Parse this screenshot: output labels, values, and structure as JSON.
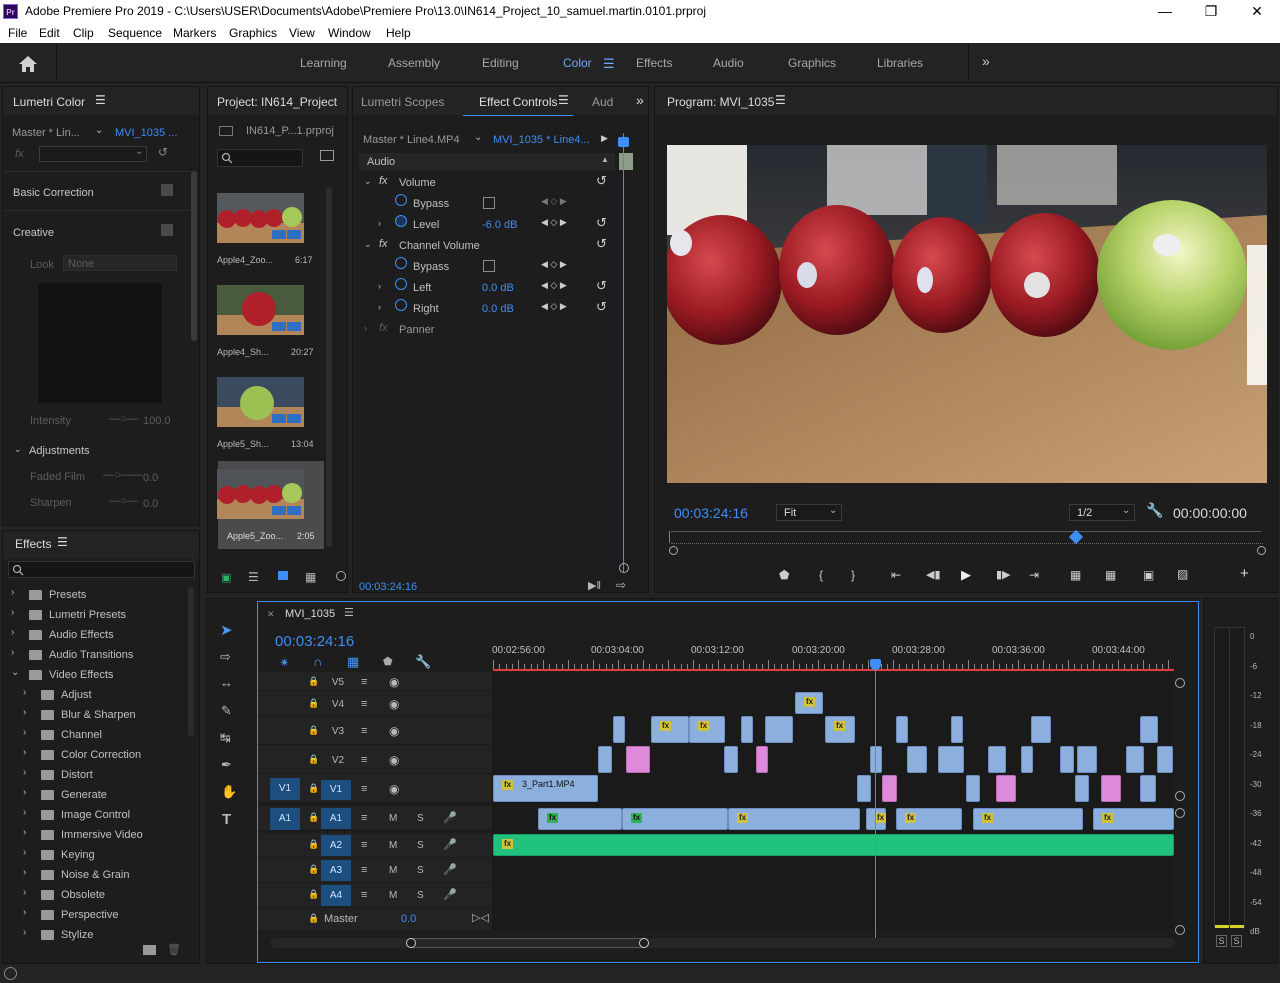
{
  "app": {
    "title": "Adobe Premiere Pro 2019 - C:\\Users\\USER\\Documents\\Adobe\\Premiere Pro\\13.0\\IN614_Project_10_samuel.martin.0101.prproj",
    "logo": "Pr"
  },
  "menu": [
    "File",
    "Edit",
    "Clip",
    "Sequence",
    "Markers",
    "Graphics",
    "View",
    "Window",
    "Help"
  ],
  "workspaces": [
    "Learning",
    "Assembly",
    "Editing",
    "Color",
    "Effects",
    "Audio",
    "Graphics",
    "Libraries"
  ],
  "workspace_active": "Color",
  "lumetri": {
    "title": "Lumetri Color",
    "source": "Master * Lin...",
    "clip": "MVI_1035 ...",
    "fx": "fx",
    "basic": "Basic Correction",
    "creative": "Creative",
    "look_label": "Look",
    "look_value": "None",
    "intensity_label": "Intensity",
    "intensity_value": "100.0",
    "adjustments": "Adjustments",
    "faded_film": "Faded Film",
    "faded_value": "0.0",
    "sharpen": "Sharpen",
    "sharpen_value": "0.0"
  },
  "project": {
    "title": "Project: IN614_Project",
    "file": "IN614_P...1.prproj",
    "items": [
      {
        "name": "Apple4_Zoo...",
        "dur": "6:17"
      },
      {
        "name": "Apple4_Sh...",
        "dur": "20:27"
      },
      {
        "name": "Apple5_Sh...",
        "dur": "13:04"
      },
      {
        "name": "Apple5_Zoo...",
        "dur": "2:05"
      }
    ]
  },
  "effectcontrols": {
    "tab1": "Lumetri Scopes",
    "tab2": "Effect Controls",
    "tab3": "Aud",
    "source": "Master * Line4.MP4",
    "clip": "MVI_1035 * Line4...",
    "audio": "Audio",
    "volume": "Volume",
    "bypass": "Bypass",
    "level": "Level",
    "level_value": "-6.0 dB",
    "channel_volume": "Channel Volume",
    "bypass2": "Bypass",
    "left": "Left",
    "left_value": "0.0 dB",
    "right": "Right",
    "right_value": "0.0 dB",
    "panner": "Panner",
    "timecode": "00:03:24:16"
  },
  "program": {
    "title": "Program: MVI_1035",
    "timecode": "00:03:24:16",
    "fit": "Fit",
    "res": "1/2",
    "end_tc": "00:00:00:00"
  },
  "effects": {
    "title": "Effects",
    "items": [
      {
        "name": "Presets",
        "level": 0
      },
      {
        "name": "Lumetri Presets",
        "level": 0
      },
      {
        "name": "Audio Effects",
        "level": 0
      },
      {
        "name": "Audio Transitions",
        "level": 0
      },
      {
        "name": "Video Effects",
        "level": 0,
        "open": true
      },
      {
        "name": "Adjust",
        "level": 1
      },
      {
        "name": "Blur & Sharpen",
        "level": 1
      },
      {
        "name": "Channel",
        "level": 1
      },
      {
        "name": "Color Correction",
        "level": 1
      },
      {
        "name": "Distort",
        "level": 1
      },
      {
        "name": "Generate",
        "level": 1
      },
      {
        "name": "Image Control",
        "level": 1
      },
      {
        "name": "Immersive Video",
        "level": 1
      },
      {
        "name": "Keying",
        "level": 1
      },
      {
        "name": "Noise & Grain",
        "level": 1
      },
      {
        "name": "Obsolete",
        "level": 1
      },
      {
        "name": "Perspective",
        "level": 1
      },
      {
        "name": "Stylize",
        "level": 1
      }
    ]
  },
  "timeline": {
    "seq": "MVI_1035",
    "timecode": "00:03:24:16",
    "ruler": [
      "00:02:56:00",
      "00:03:04:00",
      "00:03:12:00",
      "00:03:20:00",
      "00:03:28:00",
      "00:03:36:00",
      "00:03:44:00"
    ],
    "vtracks": [
      "V5",
      "V4",
      "V3",
      "V2",
      "V1"
    ],
    "atracks": [
      "A1",
      "A2",
      "A3",
      "A4"
    ],
    "src_v": "V1",
    "src_a": "A1",
    "master": "Master",
    "master_value": "0.0",
    "clip_name": "3_Part1.MP4",
    "m": "M",
    "s": "S",
    "fx": "fx"
  },
  "meter": {
    "scale": [
      "0",
      "-6",
      "-12",
      "-18",
      "-24",
      "-30",
      "-36",
      "-42",
      "-48",
      "-54",
      "dB"
    ],
    "s1": "S",
    "s2": "S"
  }
}
